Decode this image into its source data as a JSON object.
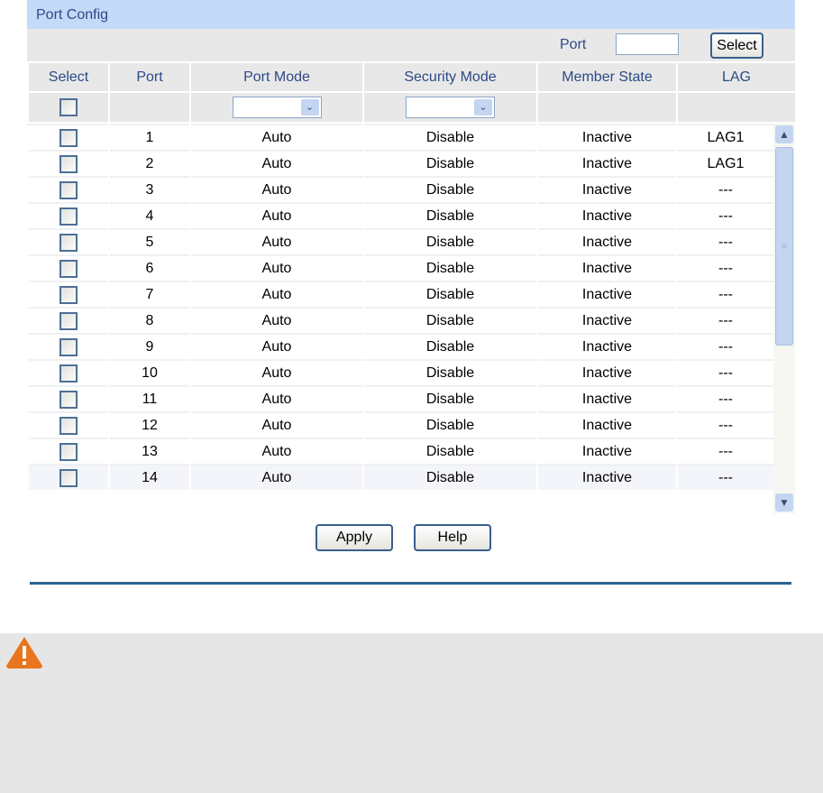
{
  "title": "Port Config",
  "port_search": {
    "label": "Port",
    "value": "",
    "button": "Select"
  },
  "columns": [
    "Select",
    "Port",
    "Port Mode",
    "Security Mode",
    "Member State",
    "LAG"
  ],
  "rows": [
    {
      "port": "1",
      "mode": "Auto",
      "security": "Disable",
      "state": "Inactive",
      "lag": "LAG1"
    },
    {
      "port": "2",
      "mode": "Auto",
      "security": "Disable",
      "state": "Inactive",
      "lag": "LAG1"
    },
    {
      "port": "3",
      "mode": "Auto",
      "security": "Disable",
      "state": "Inactive",
      "lag": "---"
    },
    {
      "port": "4",
      "mode": "Auto",
      "security": "Disable",
      "state": "Inactive",
      "lag": "---"
    },
    {
      "port": "5",
      "mode": "Auto",
      "security": "Disable",
      "state": "Inactive",
      "lag": "---"
    },
    {
      "port": "6",
      "mode": "Auto",
      "security": "Disable",
      "state": "Inactive",
      "lag": "---"
    },
    {
      "port": "7",
      "mode": "Auto",
      "security": "Disable",
      "state": "Inactive",
      "lag": "---"
    },
    {
      "port": "8",
      "mode": "Auto",
      "security": "Disable",
      "state": "Inactive",
      "lag": "---"
    },
    {
      "port": "9",
      "mode": "Auto",
      "security": "Disable",
      "state": "Inactive",
      "lag": "---"
    },
    {
      "port": "10",
      "mode": "Auto",
      "security": "Disable",
      "state": "Inactive",
      "lag": "---"
    },
    {
      "port": "11",
      "mode": "Auto",
      "security": "Disable",
      "state": "Inactive",
      "lag": "---"
    },
    {
      "port": "12",
      "mode": "Auto",
      "security": "Disable",
      "state": "Inactive",
      "lag": "---"
    },
    {
      "port": "13",
      "mode": "Auto",
      "security": "Disable",
      "state": "Inactive",
      "lag": "---"
    },
    {
      "port": "14",
      "mode": "Auto",
      "security": "Disable",
      "state": "Inactive",
      "lag": "---"
    }
  ],
  "buttons": {
    "apply": "Apply",
    "help": "Help"
  },
  "icons": {
    "warning": "warning-triangle-icon"
  },
  "colors": {
    "title_bg": "#c5d9f8",
    "accent": "#2a6490",
    "warning": "#e8761e"
  }
}
